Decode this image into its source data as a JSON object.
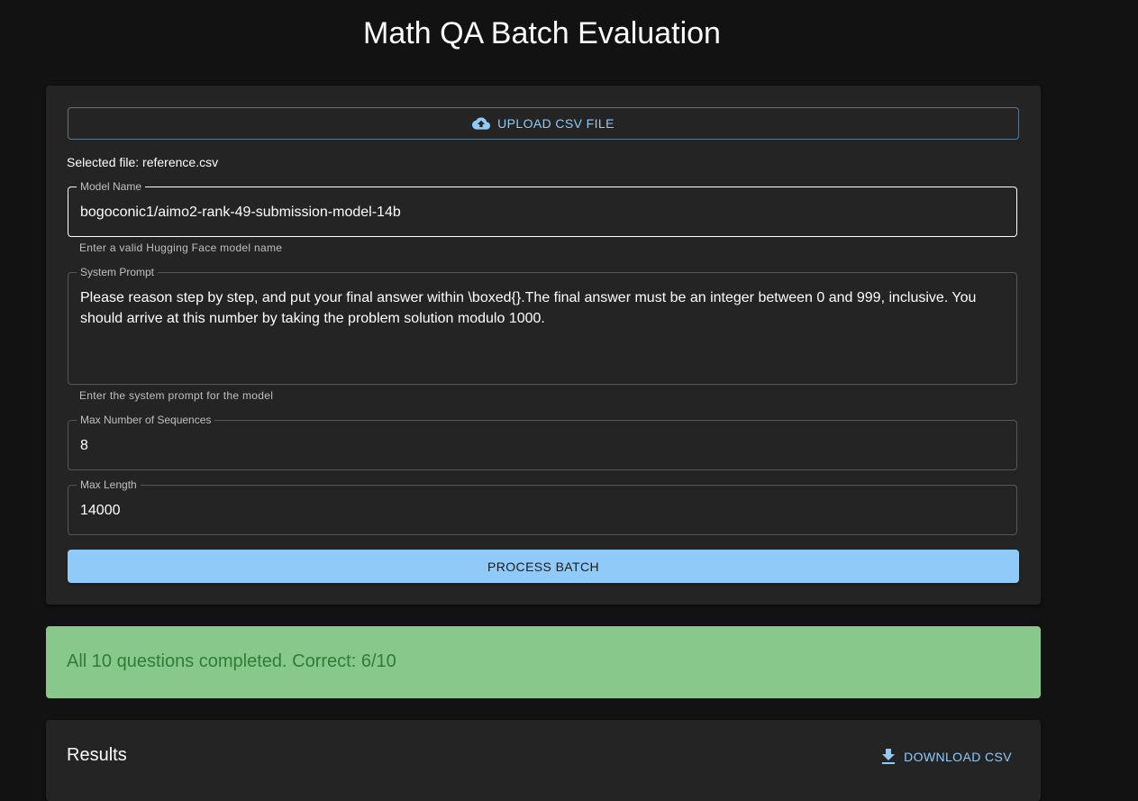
{
  "header": {
    "title": "Math QA Batch Evaluation"
  },
  "form": {
    "upload_label": "UPLOAD CSV FILE",
    "upload_icon": "cloud-upload-icon",
    "selected_file": "Selected file: reference.csv",
    "model_name": {
      "label": "Model Name",
      "value": "bogoconic1/aimo2-rank-49-submission-model-14b",
      "helper": "Enter a valid Hugging Face model name"
    },
    "system_prompt": {
      "label": "System Prompt",
      "value": "Please reason step by step, and put your final answer within \\boxed{}.The final answer must be an integer between 0 and 999, inclusive. You should arrive at this number by taking the problem solution modulo 1000.",
      "helper": "Enter the system prompt for the model"
    },
    "max_sequences": {
      "label": "Max Number of Sequences",
      "value": "8"
    },
    "max_length": {
      "label": "Max Length",
      "value": "14000"
    },
    "process_label": "PROCESS BATCH"
  },
  "status": {
    "message": "All 10 questions completed. Correct: 6/10"
  },
  "results": {
    "title": "Results",
    "download_label": "DOWNLOAD CSV",
    "download_icon": "download-icon"
  },
  "colors": {
    "background": "#121212",
    "card": "#242424",
    "accent": "#90caf9",
    "success_bg": "#88c98b",
    "success_text": "#2e7d32"
  }
}
